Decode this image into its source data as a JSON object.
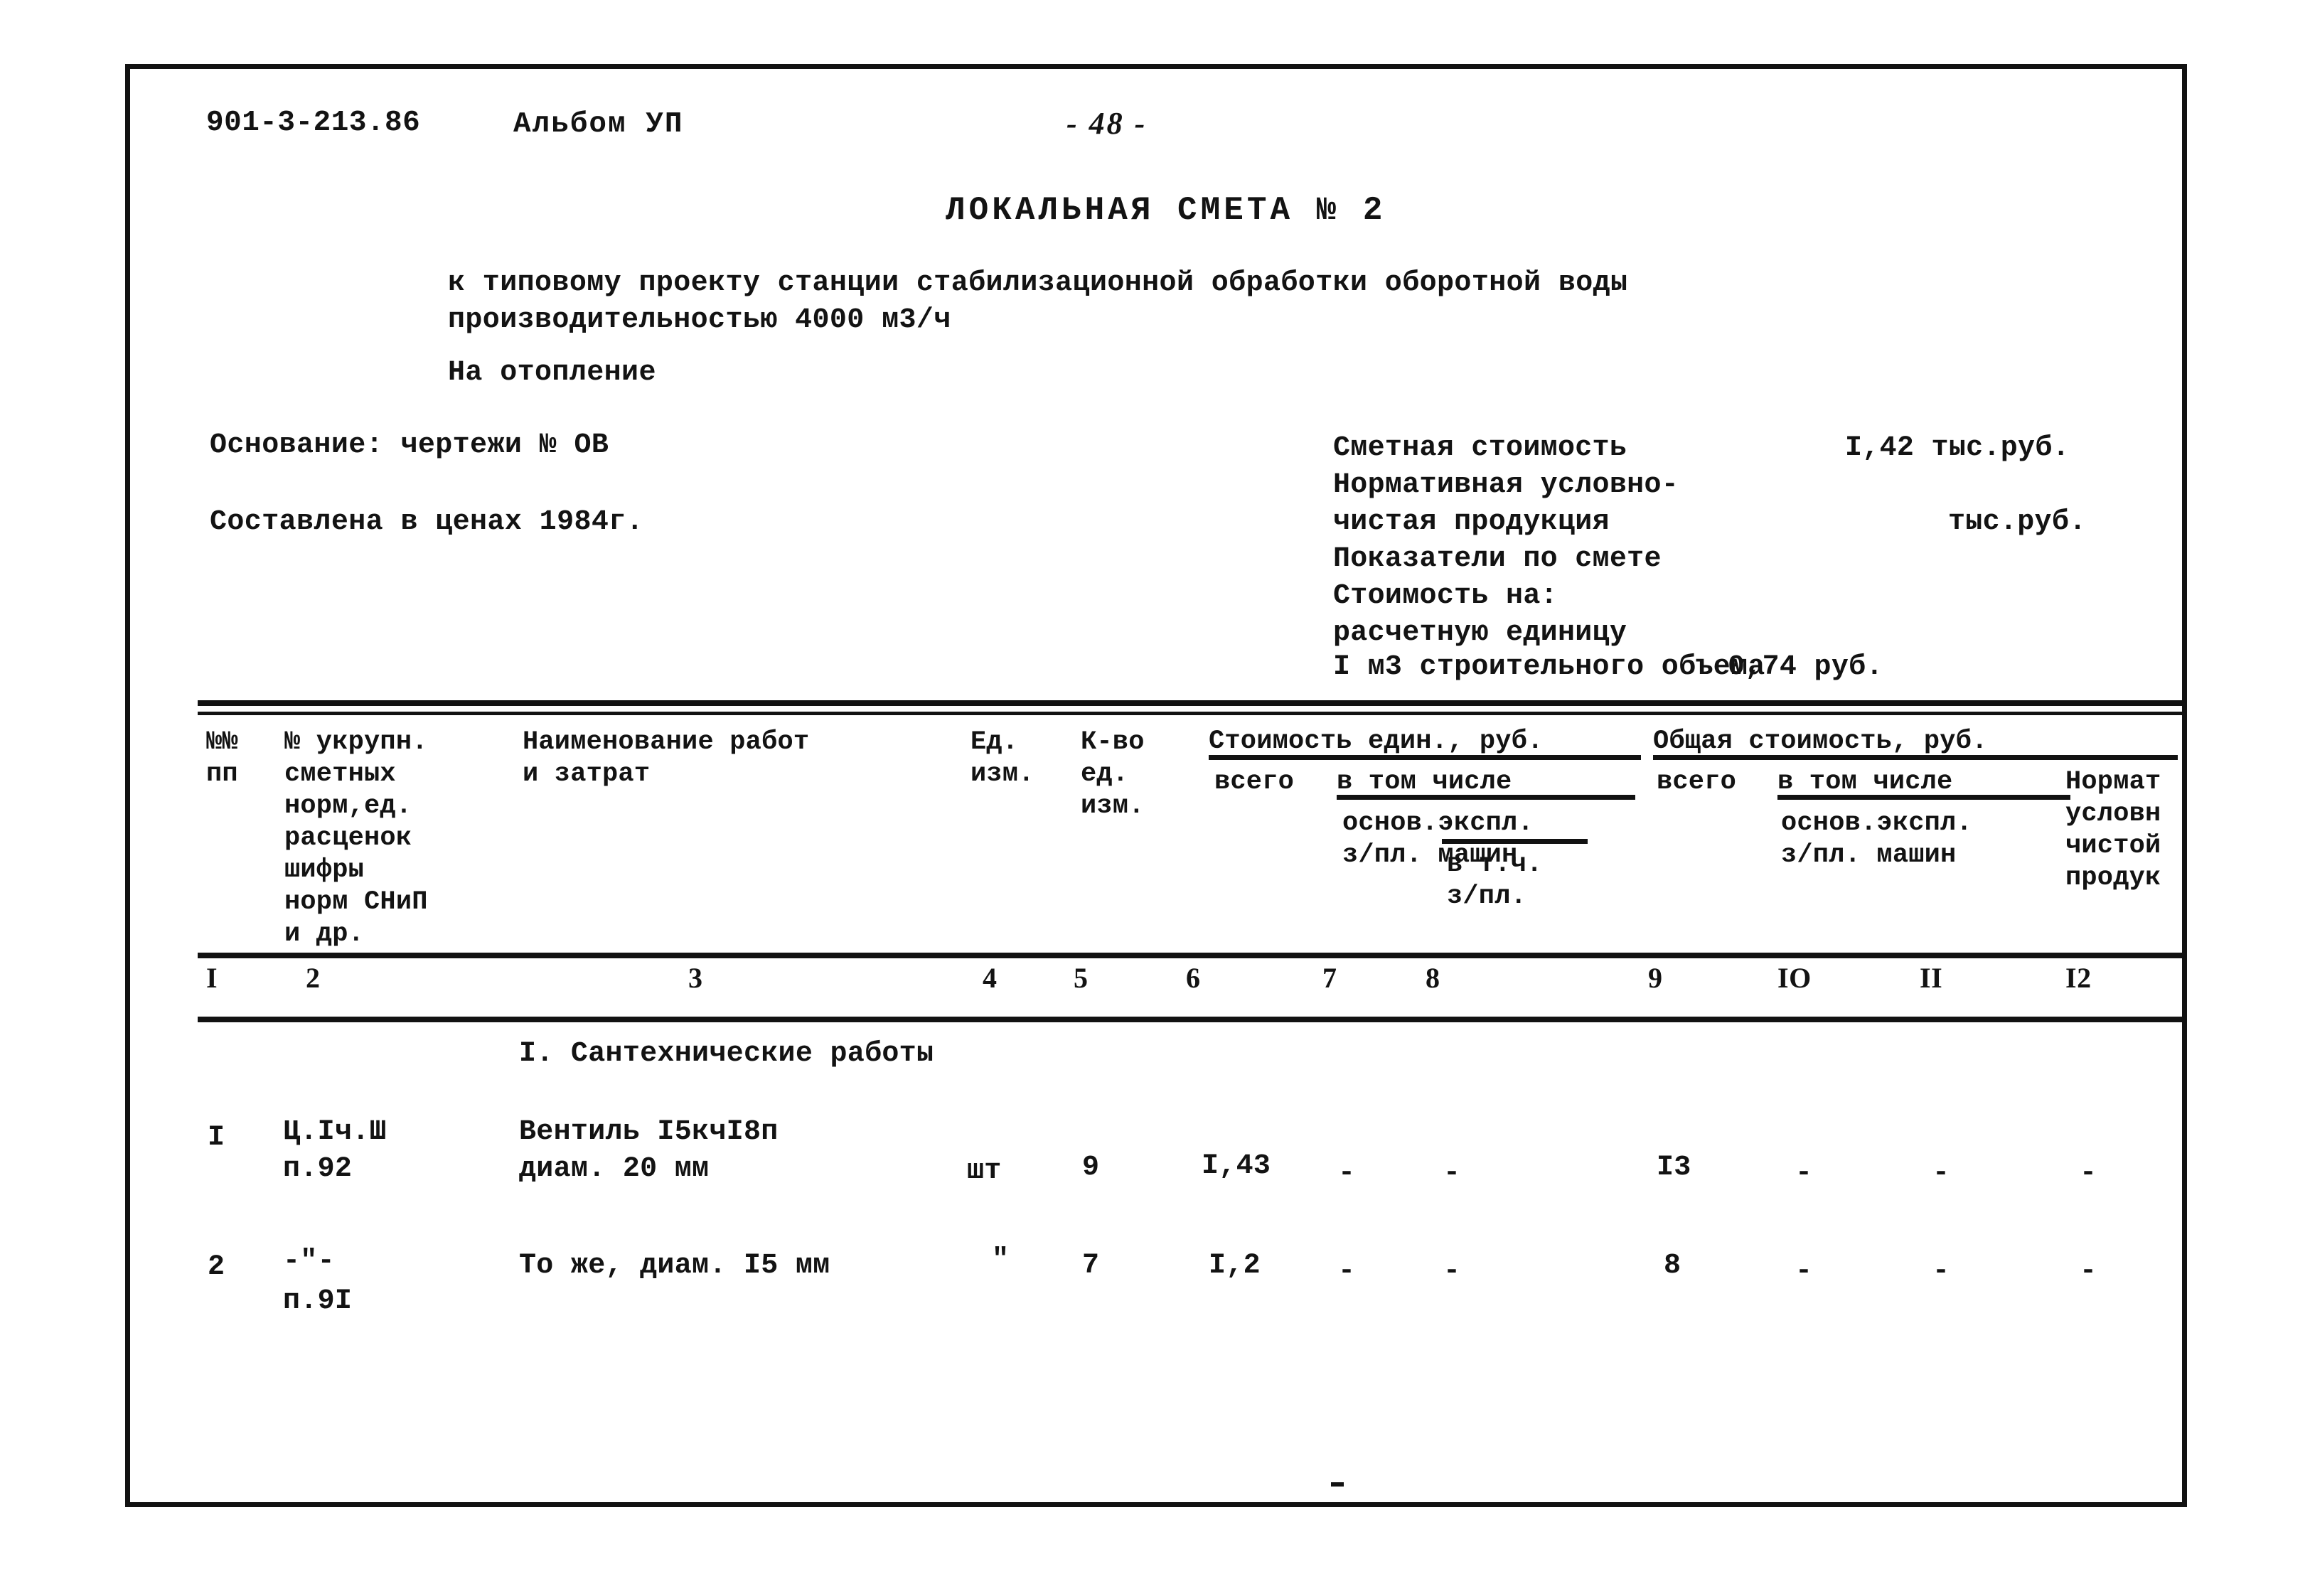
{
  "header": {
    "doc_code": "901-3-213.86",
    "album": "Альбом УП",
    "page_number": "- 48 -"
  },
  "title": "ЛОКАЛЬНАЯ СМЕТА № 2",
  "subtitle": {
    "line1": "к типовому проекту станции стабилизационной обработки оборотной воды",
    "line2": "производительностью 4000 м3/ч",
    "line3": "На отопление"
  },
  "basis": {
    "basis_label": "Основание: чертежи № ОВ",
    "prices_label": "Составлена в ценах 1984г."
  },
  "summary": {
    "line1_label": "Сметная стоимость",
    "line1_value": "I,42 тыс.руб.",
    "line2_label": "Нормативная условно-",
    "line3_label": "чистая продукция",
    "line3_value": "тыс.руб.",
    "line4_label": "Показатели по смете",
    "line5_label": "Стоимость на:",
    "line6_label": "расчетную единицу",
    "line7_label": "I м3 строительного объема",
    "line7_value": "0,74 руб."
  },
  "table": {
    "headers": {
      "col1": "№№\nпп",
      "col2": "№ укрупн.\nсметных\nнорм,ед.\nрасценок\nшифры\nнорм СНиП\nи др.",
      "col3": "Наименование работ\nи затрат",
      "col4": "Ед.\nизм.",
      "col5": "К-во\nед.\nизм.",
      "group_unit_cost": "Стоимость един., руб.",
      "group_total_cost": "Общая стоимость, руб.",
      "col6": "всего",
      "col7": "в том числе",
      "col8": "основ.экспл.\nз/пл. машин",
      "col8_sub": "в т.ч.\nз/пл.",
      "col9": "всего",
      "col10": "в том числе",
      "col10_sub": "основ.экспл.\nз/пл. машин",
      "col12": "Нормат\nусловн\nчистой\nпродук"
    },
    "column_numbers": [
      "I",
      "2",
      "3",
      "4",
      "5",
      "6",
      "7",
      "8",
      "9",
      "IO",
      "II",
      "I2"
    ],
    "section_title": "I. Сантехнические работы",
    "rows": [
      {
        "no": "I",
        "code_line1": "Ц.Iч.Ш",
        "code_line2": "п.92",
        "name_line1": "Вентиль I5кчI8п",
        "name_line2": "диам. 20 мм",
        "unit": "шт",
        "qty": "9",
        "c6": "I,43",
        "c7": "-",
        "c8": "-",
        "c9": "I3",
        "c10": "-",
        "c11": "-",
        "c12": "-"
      },
      {
        "no": "2",
        "code_line1": "-\"-",
        "code_line2": "п.9I",
        "name_line1": "То же, диам. I5 мм",
        "unit": "\"",
        "qty": "7",
        "c6": "I,2",
        "c7": "-",
        "c8": "-",
        "c9": "8",
        "c10": "-",
        "c11": "-",
        "c12": "-"
      }
    ]
  }
}
